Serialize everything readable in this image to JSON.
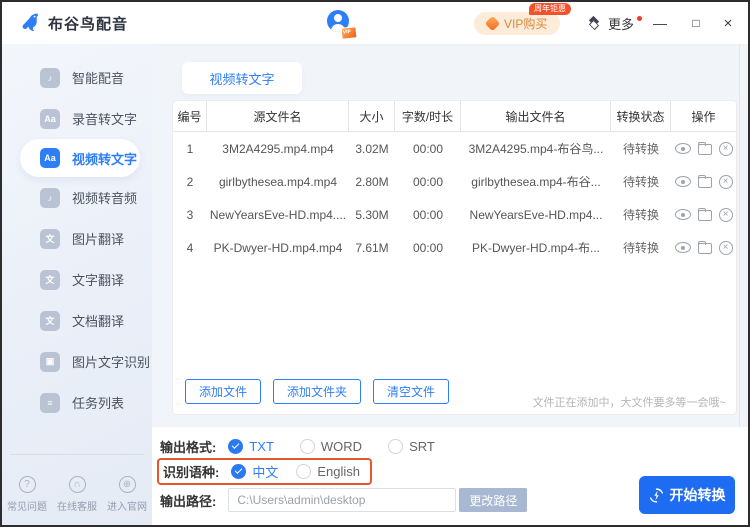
{
  "window": {
    "title": "布谷鸟配音",
    "controls": {
      "minimize": "—",
      "maximize": "□",
      "close": "×"
    }
  },
  "header": {
    "vip_button": "VIP购买",
    "vip_badge": "周年钜惠",
    "more_label": "更多"
  },
  "sidebar": {
    "items": [
      {
        "id": "smart-dubbing",
        "label": "智能配音",
        "icon": "mic-chat-icon",
        "glyph": "♪",
        "active": false
      },
      {
        "id": "audio-to-text",
        "label": "录音转文字",
        "icon": "audio-to-text-icon",
        "glyph": "Aa",
        "active": false
      },
      {
        "id": "video-to-text",
        "label": "视频转文字",
        "icon": "video-to-text-icon",
        "glyph": "Aa",
        "active": true
      },
      {
        "id": "video-to-audio",
        "label": "视频转音频",
        "icon": "video-to-audio-icon",
        "glyph": "♪",
        "active": false
      },
      {
        "id": "image-translate",
        "label": "图片翻译",
        "icon": "image-translate-icon",
        "glyph": "文",
        "active": false
      },
      {
        "id": "text-translate",
        "label": "文字翻译",
        "icon": "text-translate-icon",
        "glyph": "文",
        "active": false
      },
      {
        "id": "doc-translate",
        "label": "文档翻译",
        "icon": "doc-translate-icon",
        "glyph": "文",
        "active": false
      },
      {
        "id": "image-ocr",
        "label": "图片文字识别",
        "icon": "image-ocr-icon",
        "glyph": "▣",
        "active": false
      },
      {
        "id": "task-list",
        "label": "任务列表",
        "icon": "task-list-icon",
        "glyph": "≡",
        "active": false
      }
    ],
    "footer": [
      {
        "id": "faq",
        "label": "常见问题",
        "icon": "question-icon",
        "glyph": "?"
      },
      {
        "id": "online-service",
        "label": "在线客服",
        "icon": "headset-icon",
        "glyph": "∩"
      },
      {
        "id": "official-site",
        "label": "进入官网",
        "icon": "globe-icon",
        "glyph": "⊕"
      }
    ]
  },
  "main": {
    "tab": "视频转文字",
    "table": {
      "headers": [
        "编号",
        "源文件名",
        "大小",
        "字数/时长",
        "输出文件名",
        "转换状态",
        "操作"
      ],
      "rows": [
        {
          "no": "1",
          "source": "3M2A4295.mp4.mp4",
          "size": "3.02M",
          "duration": "00:00",
          "output": "3M2A4295.mp4-布谷鸟...",
          "status": "待转换"
        },
        {
          "no": "2",
          "source": "girlbythesea.mp4.mp4",
          "size": "2.80M",
          "duration": "00:00",
          "output": "girlbythesea.mp4-布谷...",
          "status": "待转换"
        },
        {
          "no": "3",
          "source": "NewYearsEve-HD.mp4....",
          "size": "5.30M",
          "duration": "00:00",
          "output": "NewYearsEve-HD.mp4...",
          "status": "待转换"
        },
        {
          "no": "4",
          "source": "PK-Dwyer-HD.mp4.mp4",
          "size": "7.61M",
          "duration": "00:00",
          "output": "PK-Dwyer-HD.mp4-布...",
          "status": "待转换"
        }
      ],
      "row_actions": [
        {
          "name": "preview-icon"
        },
        {
          "name": "open-folder-icon"
        },
        {
          "name": "delete-icon"
        }
      ]
    },
    "file_buttons": [
      {
        "id": "add-file",
        "label": "添加文件"
      },
      {
        "id": "add-folder",
        "label": "添加文件夹"
      },
      {
        "id": "clear-files",
        "label": "清空文件"
      }
    ],
    "note": "文件正在添加中，大文件要多等一会哦~",
    "settings": {
      "format_label": "输出格式:",
      "format_options": [
        {
          "label": "TXT",
          "selected": true
        },
        {
          "label": "WORD",
          "selected": false
        },
        {
          "label": "SRT",
          "selected": false
        }
      ],
      "language_label": "识别语种:",
      "language_options": [
        {
          "label": "中文",
          "selected": true
        },
        {
          "label": "English",
          "selected": false
        }
      ],
      "path_label": "输出路径:",
      "path_value": "C:\\Users\\admin\\desktop",
      "change_path_label": "更改路径"
    },
    "start_button": "开始转换"
  },
  "colors": {
    "primary": "#2e7ef7",
    "highlight_border": "#e4582c",
    "vip_orange": "#d8873c"
  }
}
